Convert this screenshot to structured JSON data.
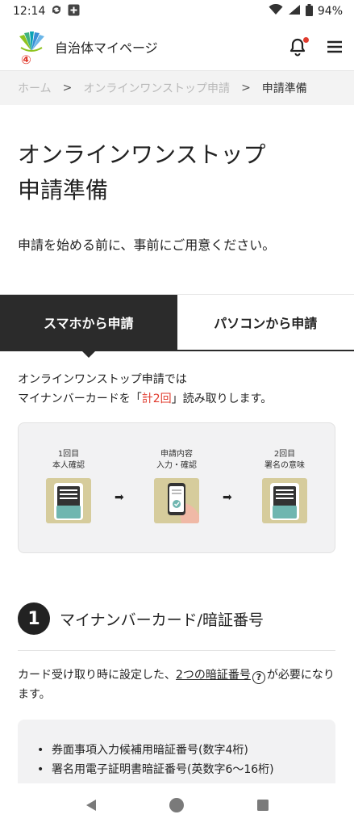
{
  "status": {
    "time": "12:14",
    "battery": "94%"
  },
  "header": {
    "title": "自治体マイページ",
    "logo_badge": "④"
  },
  "breadcrumb": {
    "items": [
      "ホーム",
      "オンラインワンストップ申請"
    ],
    "current": "申請準備",
    "separator": ">"
  },
  "page": {
    "title_line1": "オンラインワンストップ",
    "title_line2": "申請準備",
    "lead": "申請を始める前に、事前にご用意ください。"
  },
  "tabs": [
    {
      "label": "スマホから申請",
      "active": true
    },
    {
      "label": "パソコンから申請",
      "active": false
    }
  ],
  "intro": {
    "line1": "オンラインワンストップ申請では",
    "line2_pre": "マイナンバーカードを「",
    "line2_em": "計2回",
    "line2_post": "」読み取りします。"
  },
  "steps": [
    {
      "line1": "1回目",
      "line2": "本人確認"
    },
    {
      "line1": "申請内容",
      "line2": "入力・確認"
    },
    {
      "line1": "2回目",
      "line2": "署名の意味"
    }
  ],
  "arrow": "➡",
  "section1": {
    "number": "1",
    "title": "マイナンバーカード/暗証番号",
    "desc_pre": "カード受け取り時に設定した、",
    "desc_link": "2つの暗証番号",
    "help_glyph": "?",
    "desc_post": "が必要になります。",
    "items": [
      "券面事項入力候補用暗証番号(数字4桁)",
      "署名用電子証明書暗証番号(英数字6～16桁)"
    ]
  },
  "colors": {
    "accent": "#e03b2e",
    "dark": "#2b2b2b",
    "card": "#d6cc9c"
  }
}
